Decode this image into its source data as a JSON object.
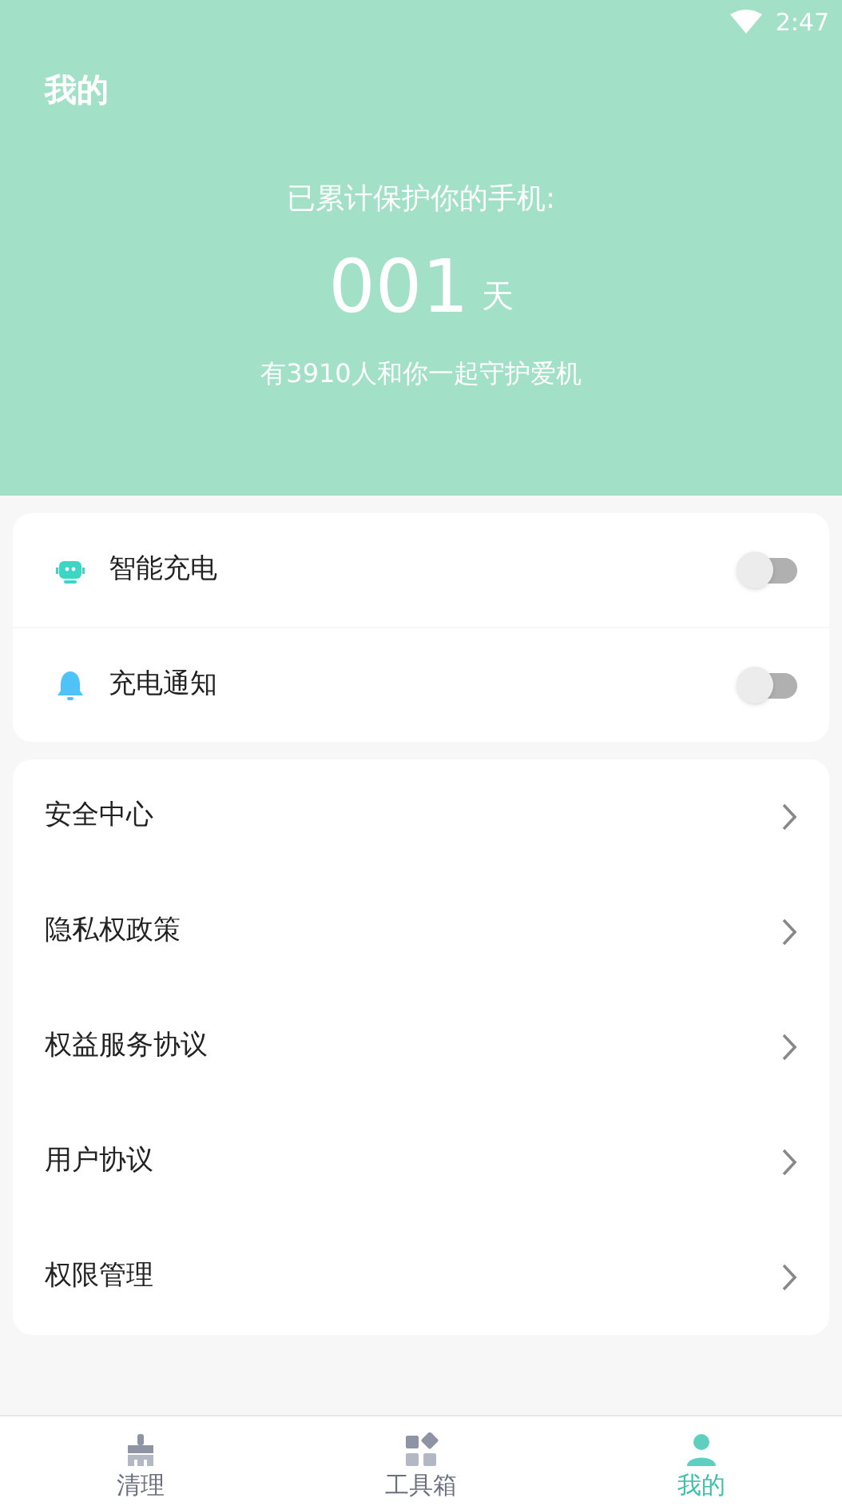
{
  "status_bar": {
    "time": "2:47"
  },
  "header": {
    "title": "我的",
    "caption": "已累计保护你的手机:",
    "days": "001",
    "days_unit": "天",
    "footnote": "有3910人和你一起守护爱机"
  },
  "toggles": [
    {
      "kind": "robot",
      "label": "智能充电",
      "on": false
    },
    {
      "kind": "bell",
      "label": "充电通知",
      "on": false
    }
  ],
  "menu": [
    {
      "label": "安全中心"
    },
    {
      "label": "隐私权政策"
    },
    {
      "label": "权益服务协议"
    },
    {
      "label": "用户协议"
    },
    {
      "label": "权限管理"
    }
  ],
  "tabs": [
    {
      "kind": "broom",
      "label": "清理",
      "selected": false
    },
    {
      "kind": "tools",
      "label": "工具箱",
      "selected": false
    },
    {
      "kind": "person",
      "label": "我的",
      "selected": true
    }
  ]
}
